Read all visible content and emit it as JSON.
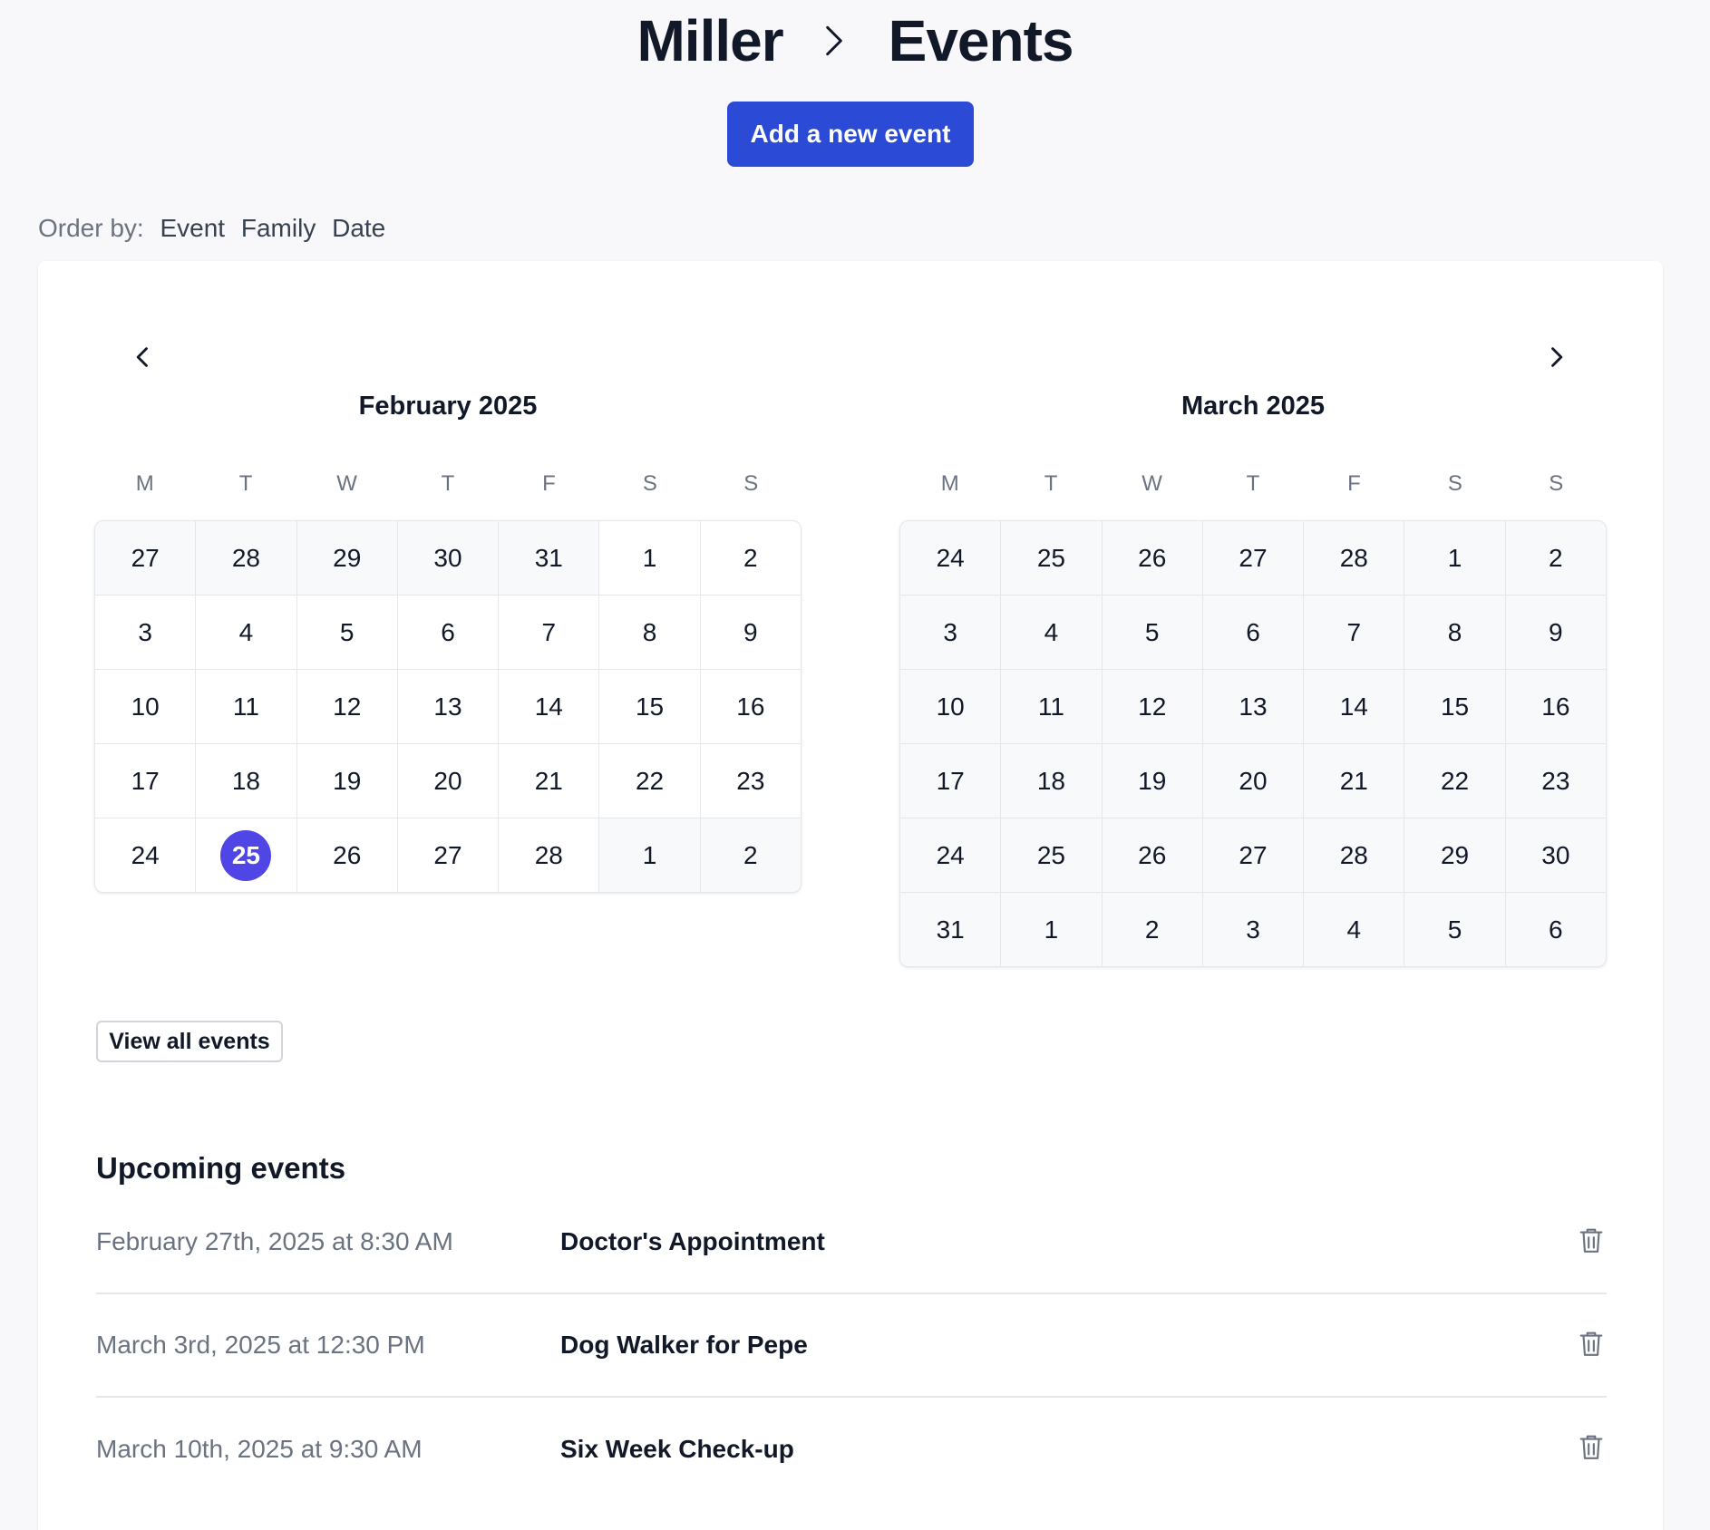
{
  "breadcrumb": {
    "parent": "Miller",
    "current": "Events"
  },
  "add_event_label": "Add a new event",
  "order_by": {
    "label": "Order by:",
    "options": [
      "Event",
      "Family",
      "Date"
    ]
  },
  "colors": {
    "primary": "#2b4ad6",
    "selected_day": "#4f46e5"
  },
  "calendar": {
    "weekdays": [
      "M",
      "T",
      "W",
      "T",
      "F",
      "S",
      "S"
    ],
    "selected_date": "February 25, 2025",
    "months": [
      {
        "title": "February 2025",
        "days": [
          {
            "d": "27",
            "out": true
          },
          {
            "d": "28",
            "out": true
          },
          {
            "d": "29",
            "out": true
          },
          {
            "d": "30",
            "out": true
          },
          {
            "d": "31",
            "out": true
          },
          {
            "d": "1"
          },
          {
            "d": "2"
          },
          {
            "d": "3"
          },
          {
            "d": "4"
          },
          {
            "d": "5"
          },
          {
            "d": "6"
          },
          {
            "d": "7"
          },
          {
            "d": "8"
          },
          {
            "d": "9"
          },
          {
            "d": "10"
          },
          {
            "d": "11"
          },
          {
            "d": "12"
          },
          {
            "d": "13"
          },
          {
            "d": "14"
          },
          {
            "d": "15"
          },
          {
            "d": "16"
          },
          {
            "d": "17"
          },
          {
            "d": "18"
          },
          {
            "d": "19"
          },
          {
            "d": "20"
          },
          {
            "d": "21"
          },
          {
            "d": "22"
          },
          {
            "d": "23"
          },
          {
            "d": "24"
          },
          {
            "d": "25",
            "selected": true
          },
          {
            "d": "26"
          },
          {
            "d": "27"
          },
          {
            "d": "28"
          },
          {
            "d": "1",
            "out": true
          },
          {
            "d": "2",
            "out": true
          }
        ]
      },
      {
        "title": "March 2025",
        "days": [
          {
            "d": "24",
            "out": true
          },
          {
            "d": "25",
            "out": true
          },
          {
            "d": "26",
            "out": true
          },
          {
            "d": "27",
            "out": true
          },
          {
            "d": "28",
            "out": true
          },
          {
            "d": "1",
            "out": true
          },
          {
            "d": "2",
            "out": true
          },
          {
            "d": "3",
            "out": true
          },
          {
            "d": "4",
            "out": true
          },
          {
            "d": "5",
            "out": true
          },
          {
            "d": "6",
            "out": true
          },
          {
            "d": "7",
            "out": true
          },
          {
            "d": "8",
            "out": true
          },
          {
            "d": "9",
            "out": true
          },
          {
            "d": "10",
            "out": true
          },
          {
            "d": "11",
            "out": true
          },
          {
            "d": "12",
            "out": true
          },
          {
            "d": "13",
            "out": true
          },
          {
            "d": "14",
            "out": true
          },
          {
            "d": "15",
            "out": true
          },
          {
            "d": "16",
            "out": true
          },
          {
            "d": "17",
            "out": true
          },
          {
            "d": "18",
            "out": true
          },
          {
            "d": "19",
            "out": true
          },
          {
            "d": "20",
            "out": true
          },
          {
            "d": "21",
            "out": true
          },
          {
            "d": "22",
            "out": true
          },
          {
            "d": "23",
            "out": true
          },
          {
            "d": "24",
            "out": true
          },
          {
            "d": "25",
            "out": true
          },
          {
            "d": "26",
            "out": true
          },
          {
            "d": "27",
            "out": true
          },
          {
            "d": "28",
            "out": true
          },
          {
            "d": "29",
            "out": true
          },
          {
            "d": "30",
            "out": true
          },
          {
            "d": "31",
            "out": true
          },
          {
            "d": "1",
            "out": true
          },
          {
            "d": "2",
            "out": true
          },
          {
            "d": "3",
            "out": true
          },
          {
            "d": "4",
            "out": true
          },
          {
            "d": "5",
            "out": true
          },
          {
            "d": "6",
            "out": true
          }
        ]
      }
    ],
    "prev_icon": "chevron-left-icon",
    "next_icon": "chevron-right-icon"
  },
  "view_all_label": "View all events",
  "upcoming": {
    "title": "Upcoming events",
    "events": [
      {
        "date": "February 27th, 2025 at 8:30 AM",
        "name": "Doctor's Appointment",
        "icon": "trash-icon"
      },
      {
        "date": "March 3rd, 2025 at 12:30 PM",
        "name": "Dog Walker for Pepe",
        "icon": "trash-icon"
      },
      {
        "date": "March 10th, 2025 at 9:30 AM",
        "name": "Six Week Check-up",
        "icon": "trash-icon"
      }
    ]
  }
}
